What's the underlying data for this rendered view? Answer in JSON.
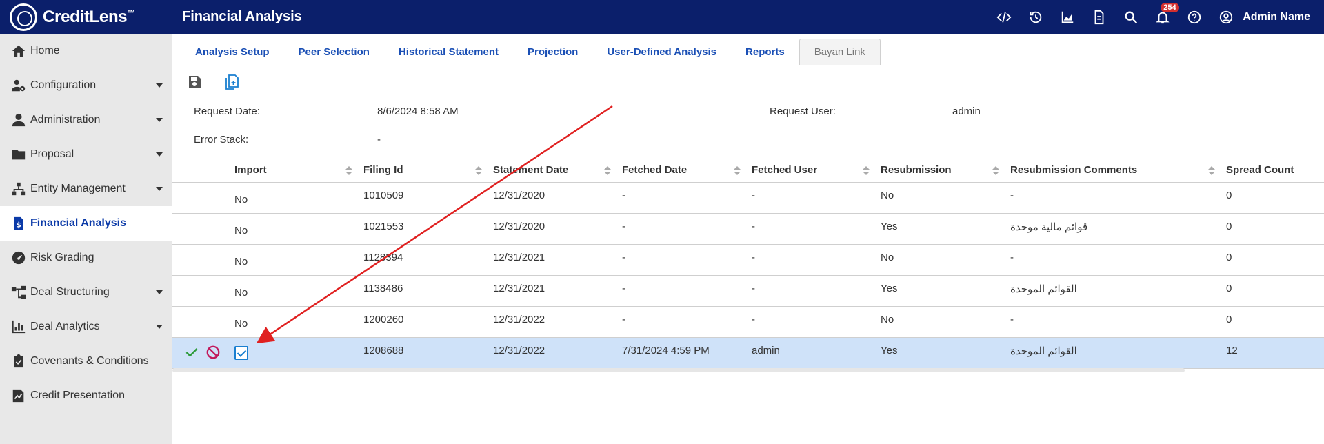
{
  "app": {
    "name": "CreditLens",
    "trademark": "™",
    "title": "Financial Analysis"
  },
  "header": {
    "notification_count": "254",
    "user": "Admin Name",
    "icons": [
      "code-icon",
      "history-icon",
      "chart-icon",
      "document-icon",
      "search-icon",
      "bell-icon",
      "help-icon",
      "user-icon"
    ]
  },
  "sidebar": {
    "items": [
      {
        "label": "Home",
        "icon": "home-icon",
        "caret": false
      },
      {
        "label": "Configuration",
        "icon": "user-gear-icon",
        "caret": true
      },
      {
        "label": "Administration",
        "icon": "person-icon",
        "caret": true
      },
      {
        "label": "Proposal",
        "icon": "folder-icon",
        "caret": true
      },
      {
        "label": "Entity Management",
        "icon": "hierarchy-icon",
        "caret": true
      },
      {
        "label": "Financial Analysis",
        "icon": "dollar-doc-icon",
        "caret": false,
        "active": true
      },
      {
        "label": "Risk Grading",
        "icon": "gauge-icon",
        "caret": false
      },
      {
        "label": "Deal Structuring",
        "icon": "network-icon",
        "caret": true
      },
      {
        "label": "Deal Analytics",
        "icon": "bar-chart-icon",
        "caret": true
      },
      {
        "label": "Covenants & Conditions",
        "icon": "clipboard-icon",
        "caret": false
      },
      {
        "label": "Credit Presentation",
        "icon": "presentation-icon",
        "caret": false
      }
    ]
  },
  "tabs": [
    {
      "label": "Analysis Setup"
    },
    {
      "label": "Peer Selection"
    },
    {
      "label": "Historical Statement"
    },
    {
      "label": "Projection"
    },
    {
      "label": "User-Defined Analysis"
    },
    {
      "label": "Reports"
    },
    {
      "label": "Bayan Link",
      "active": true
    }
  ],
  "info": {
    "request_date_label": "Request Date:",
    "request_date": "8/6/2024 8:58 AM",
    "request_user_label": "Request User:",
    "request_user": "admin",
    "error_stack_label": "Error Stack:",
    "error_stack": "-"
  },
  "table": {
    "columns": [
      "Import",
      "Filing Id",
      "Statement Date",
      "Fetched Date",
      "Fetched User",
      "Resubmission",
      "Resubmission Comments",
      "Spread Count"
    ],
    "rows": [
      [
        "No",
        "1010509",
        "12/31/2020",
        "-",
        "-",
        "No",
        "-",
        "0"
      ],
      [
        "No",
        "1021553",
        "12/31/2020",
        "-",
        "-",
        "Yes",
        "قوائم مالية موحدة",
        "0"
      ],
      [
        "No",
        "1128394",
        "12/31/2021",
        "-",
        "-",
        "No",
        "-",
        "0"
      ],
      [
        "No",
        "1138486",
        "12/31/2021",
        "-",
        "-",
        "Yes",
        "القوائم الموحدة",
        "0"
      ],
      [
        "No",
        "1200260",
        "12/31/2022",
        "-",
        "-",
        "No",
        "-",
        "0"
      ],
      [
        "",
        "1208688",
        "12/31/2022",
        "7/31/2024 4:59 PM",
        "admin",
        "Yes",
        "القوائم الموحدة",
        "12"
      ]
    ]
  },
  "colors": {
    "header_bg": "#0b1f6b",
    "accent": "#1a4fb5",
    "selected_row": "#cfe2f9",
    "annotation": "#e02020"
  }
}
